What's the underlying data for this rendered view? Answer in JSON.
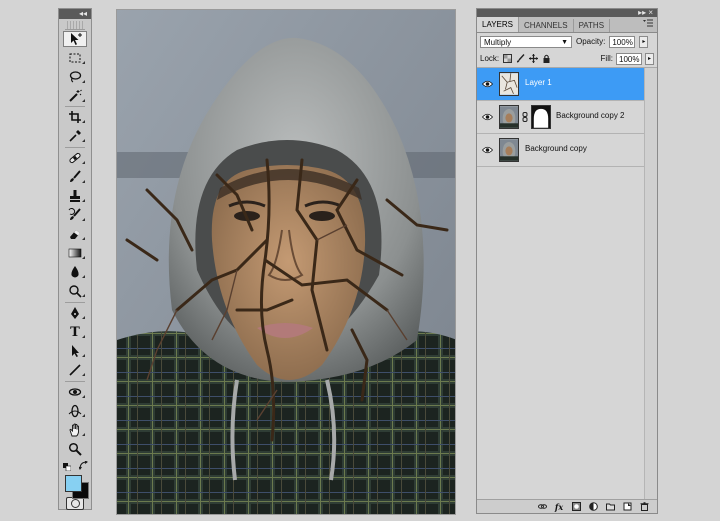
{
  "tools": {
    "header_glyph": "◂◂",
    "items": [
      {
        "name": "move-tool",
        "icon": "move-icon"
      },
      {
        "name": "marquee-tool",
        "icon": "marquee-icon"
      },
      {
        "name": "lasso-tool",
        "icon": "lasso-icon"
      },
      {
        "name": "magic-wand-tool",
        "icon": "magic-wand-icon"
      },
      {
        "name": "crop-tool",
        "icon": "crop-icon"
      },
      {
        "name": "eyedropper-tool",
        "icon": "eyedropper-icon"
      },
      {
        "name": "healing-brush-tool",
        "icon": "bandage-icon"
      },
      {
        "name": "brush-tool",
        "icon": "brush-icon"
      },
      {
        "name": "clone-stamp-tool",
        "icon": "stamp-icon"
      },
      {
        "name": "history-brush-tool",
        "icon": "history-brush-icon"
      },
      {
        "name": "eraser-tool",
        "icon": "eraser-icon"
      },
      {
        "name": "gradient-tool",
        "icon": "gradient-icon"
      },
      {
        "name": "blur-tool",
        "icon": "drop-icon"
      },
      {
        "name": "dodge-tool",
        "icon": "dodge-icon"
      },
      {
        "name": "pen-tool",
        "icon": "pen-icon"
      },
      {
        "name": "type-tool",
        "icon": "type-icon"
      },
      {
        "name": "path-selection-tool",
        "icon": "arrow-icon"
      },
      {
        "name": "line-tool",
        "icon": "line-icon"
      },
      {
        "name": "3d-rotate-tool",
        "icon": "3d-rotate-icon"
      },
      {
        "name": "3d-orbit-tool",
        "icon": "3d-orbit-icon"
      },
      {
        "name": "hand-tool",
        "icon": "hand-icon"
      },
      {
        "name": "zoom-tool",
        "icon": "zoom-icon"
      }
    ],
    "type_glyph": "T",
    "foreground_color": "#87d0f2",
    "background_color": "#0a0a0a"
  },
  "layers_panel": {
    "header_glyph": "▸▸",
    "close_glyph": "×",
    "tabs": [
      "LAYERS",
      "CHANNELS",
      "PATHS"
    ],
    "active_tab": "LAYERS",
    "blend_mode": "Multiply",
    "opacity_label": "Opacity:",
    "opacity_value": "100%",
    "lock_label": "Lock:",
    "fill_label": "Fill:",
    "fill_value": "100%",
    "layers": [
      {
        "name": "Layer 1",
        "selected": true,
        "visible": true,
        "has_mask": false
      },
      {
        "name": "Background copy 2",
        "selected": false,
        "visible": true,
        "has_mask": true
      },
      {
        "name": "Background copy",
        "selected": false,
        "visible": true,
        "has_mask": false
      }
    ],
    "selection_color": "#3d9bf5"
  }
}
